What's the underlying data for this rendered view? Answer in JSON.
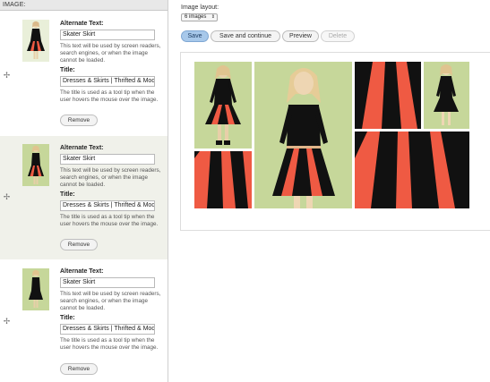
{
  "panel": {
    "header": "IMAGE:"
  },
  "rows": [
    {
      "alt_label": "Alternate Text:",
      "alt_value": "Skater Skirt",
      "alt_help": "This text will be used by screen readers, search engines, or when the image cannot be loaded.",
      "title_label": "Title:",
      "title_value": "Dresses & Skirts | Thrifted & Modern",
      "title_help": "The title is used as a tool tip when the user hovers the mouse over the image.",
      "remove_label": "Remove"
    },
    {
      "alt_label": "Alternate Text:",
      "alt_value": "Skater Skirt",
      "alt_help": "This text will be used by screen readers, search engines, or when the image cannot be loaded.",
      "title_label": "Title:",
      "title_value": "Dresses & Skirts | Thrifted & Modern",
      "title_help": "The title is used as a tool tip when the user hovers the mouse over the image.",
      "remove_label": "Remove"
    },
    {
      "alt_label": "Alternate Text:",
      "alt_value": "Skater Skirt",
      "alt_help": "This text will be used by screen readers, search engines, or when the image cannot be loaded.",
      "title_label": "Title:",
      "title_value": "Dresses & Skirts | Thrifted & Modern",
      "title_help": "The title is used as a tool tip when the user hovers the mouse over the image.",
      "remove_label": "Remove"
    }
  ],
  "layout": {
    "label": "Image layout:",
    "selected": "6 images"
  },
  "buttons": {
    "save": "Save",
    "save_continue": "Save and continue",
    "preview": "Preview",
    "delete": "Delete"
  },
  "icons": {
    "drag_handle": "move-cross-icon",
    "select_arrow": "up-down-arrows-icon"
  },
  "colors": {
    "photo_background_green": "#c6d79a",
    "dress_black": "#111111",
    "skirt_coral": "#ef5a43",
    "alt_row_background": "#f0f1ea",
    "primary_button": "#a7c8ea"
  }
}
